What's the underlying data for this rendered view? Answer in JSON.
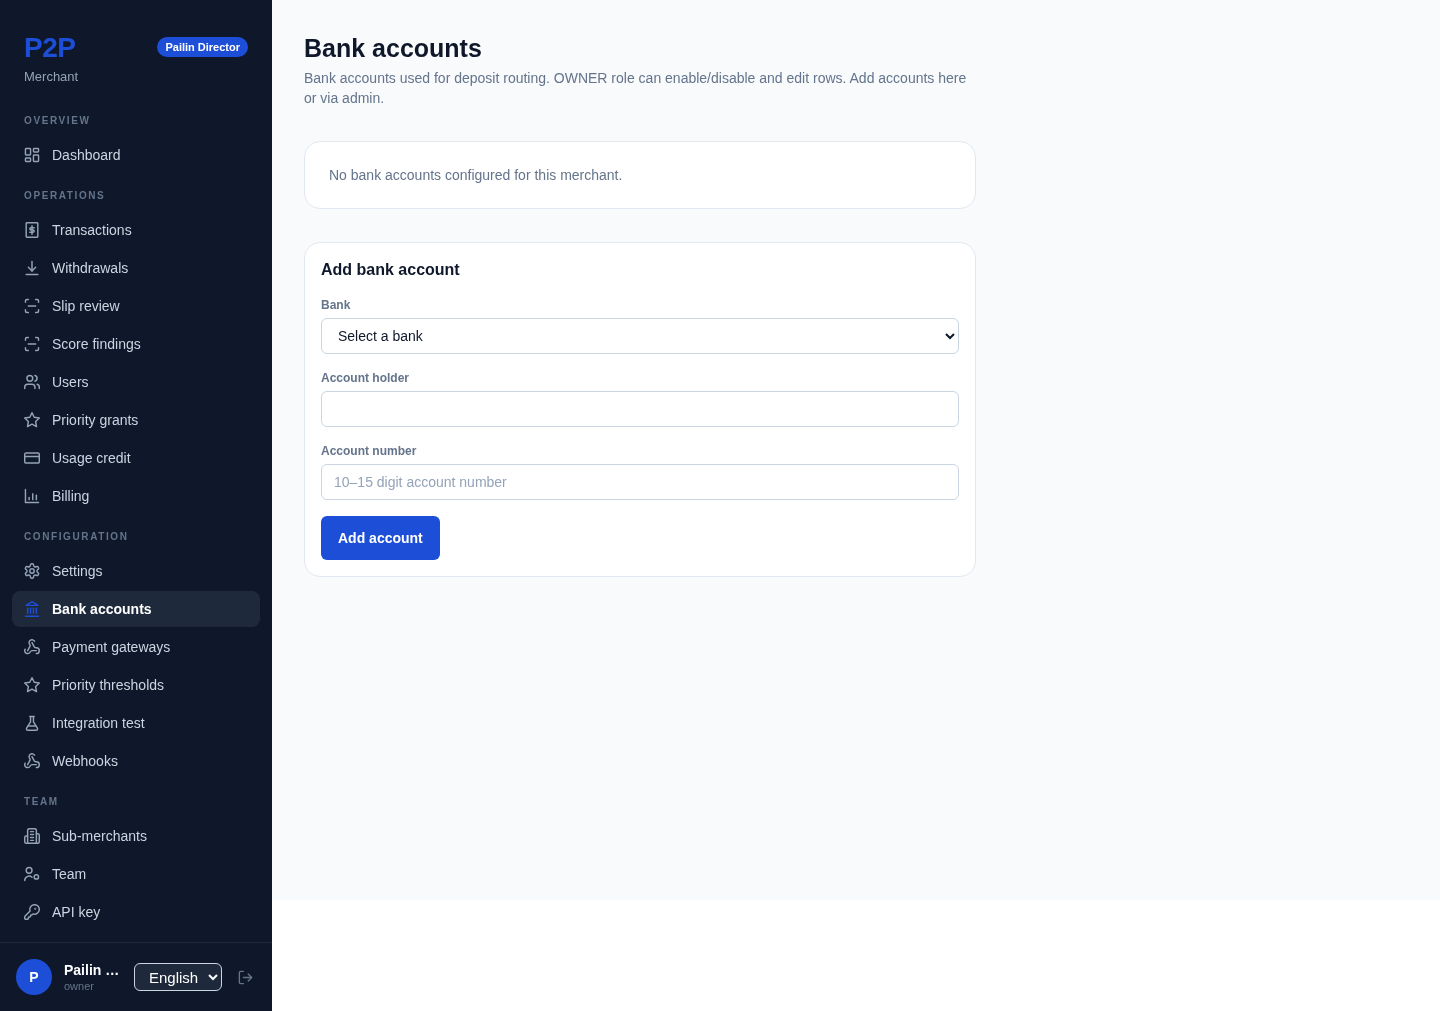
{
  "sidebar": {
    "logo": "P2P",
    "subtitle": "Merchant",
    "role_badge": "Pailin Director",
    "sections": [
      {
        "label": "OVERVIEW",
        "items": [
          {
            "label": "Dashboard",
            "selected": false
          }
        ]
      },
      {
        "label": "OPERATIONS",
        "items": [
          {
            "label": "Transactions",
            "selected": false
          },
          {
            "label": "Withdrawals",
            "selected": false
          },
          {
            "label": "Slip review",
            "selected": false
          },
          {
            "label": "Score findings",
            "selected": false
          },
          {
            "label": "Users",
            "selected": false
          },
          {
            "label": "Priority grants",
            "selected": false
          },
          {
            "label": "Usage credit",
            "selected": false
          },
          {
            "label": "Billing",
            "selected": false
          }
        ]
      },
      {
        "label": "CONFIGURATION",
        "items": [
          {
            "label": "Settings",
            "selected": false
          },
          {
            "label": "Bank accounts",
            "selected": true
          },
          {
            "label": "Payment gateways",
            "selected": false
          },
          {
            "label": "Priority thresholds",
            "selected": false
          },
          {
            "label": "Integration test",
            "selected": false
          },
          {
            "label": "Webhooks",
            "selected": false
          }
        ]
      },
      {
        "label": "TEAM",
        "items": [
          {
            "label": "Sub-merchants",
            "selected": false
          },
          {
            "label": "Team",
            "selected": false
          },
          {
            "label": "API key",
            "selected": false
          }
        ]
      }
    ],
    "footer": {
      "avatar": "P",
      "name": "Pailin …",
      "role": "owner",
      "language": "English"
    }
  },
  "page": {
    "title": "Bank accounts",
    "description": "Bank accounts used for deposit routing. OWNER role can enable/disable and edit rows. Add accounts here or via admin.",
    "empty_message": "No bank accounts configured for this merchant.",
    "form": {
      "title": "Add bank account",
      "fields": [
        {
          "kind": "select",
          "label": "Bank",
          "value": "Select a bank"
        },
        {
          "kind": "text",
          "label": "Account holder"
        },
        {
          "kind": "text",
          "label": "Account number",
          "placeholder": "10–15 digit account number"
        }
      ],
      "submit": "Add account"
    }
  }
}
